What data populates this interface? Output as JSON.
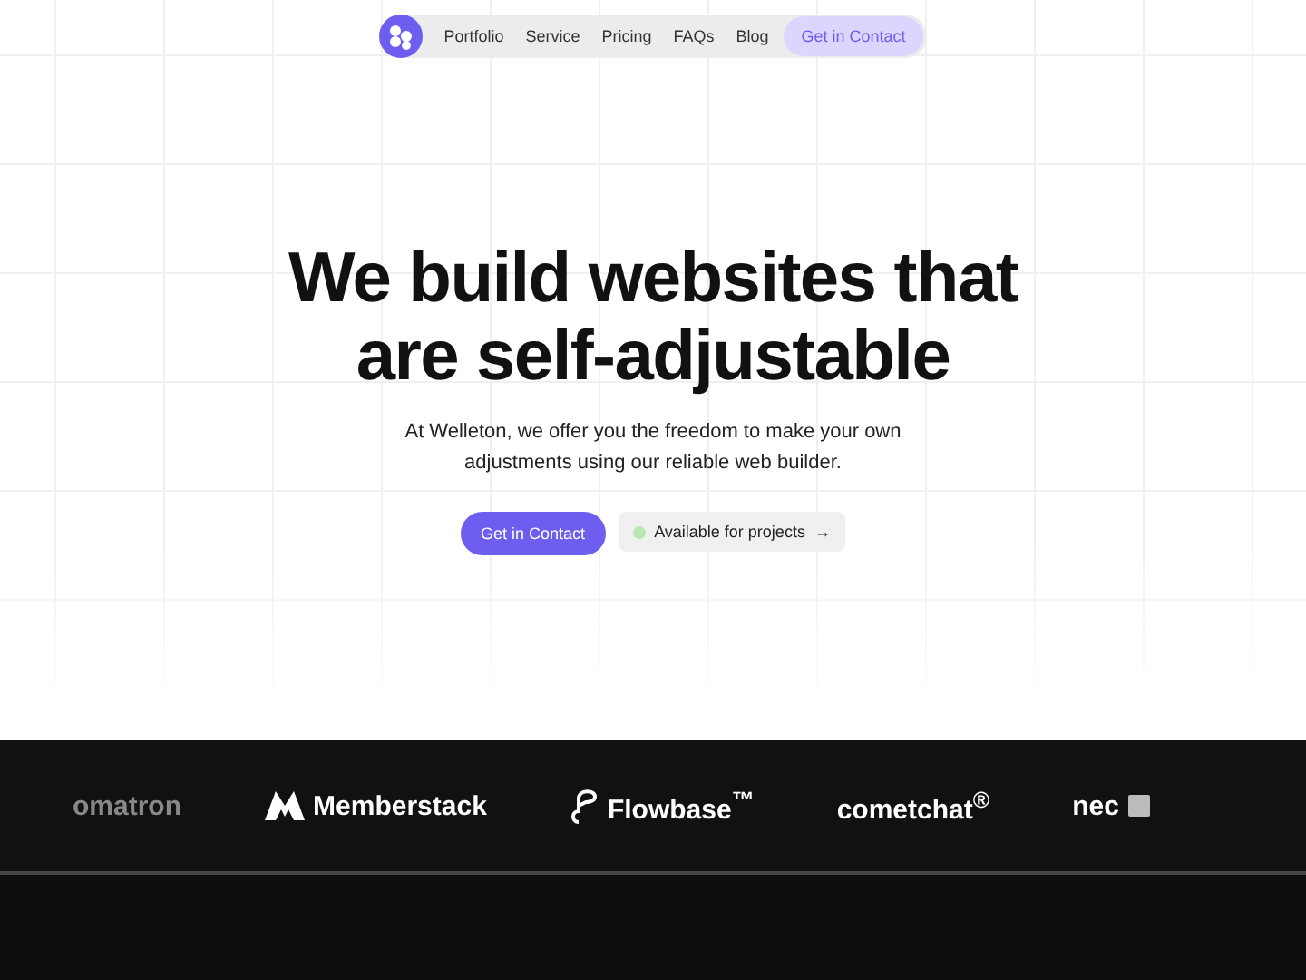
{
  "nav": {
    "links": [
      {
        "label": "Portfolio"
      },
      {
        "label": "Service"
      },
      {
        "label": "Pricing"
      },
      {
        "label": "FAQs"
      },
      {
        "label": "Blog"
      }
    ],
    "cta": "Get in Contact"
  },
  "hero": {
    "title_lines": [
      "We build websites that",
      "are self-adjustable"
    ],
    "subtitle_lines": [
      "At Welleton, we offer you the freedom to make your own",
      "adjustments using our reliable web builder."
    ],
    "primary_button": "Get in Contact",
    "status_button": {
      "label": "Available for projects",
      "arrow": "→",
      "color": "#b9e6b3"
    }
  },
  "logos": [
    {
      "name": "omatron",
      "kind": "plain",
      "faded": true
    },
    {
      "name": "Memberstack",
      "kind": "mark",
      "faded": false
    },
    {
      "name": "Flowbase$^{™}$",
      "kind": "loop",
      "faded": false
    },
    {
      "name": "comet**chat**$^{®}$",
      "kind": "plain",
      "faded": false
    },
    {
      "name": "nec",
      "kind": "square",
      "faded": false
    }
  ]
}
